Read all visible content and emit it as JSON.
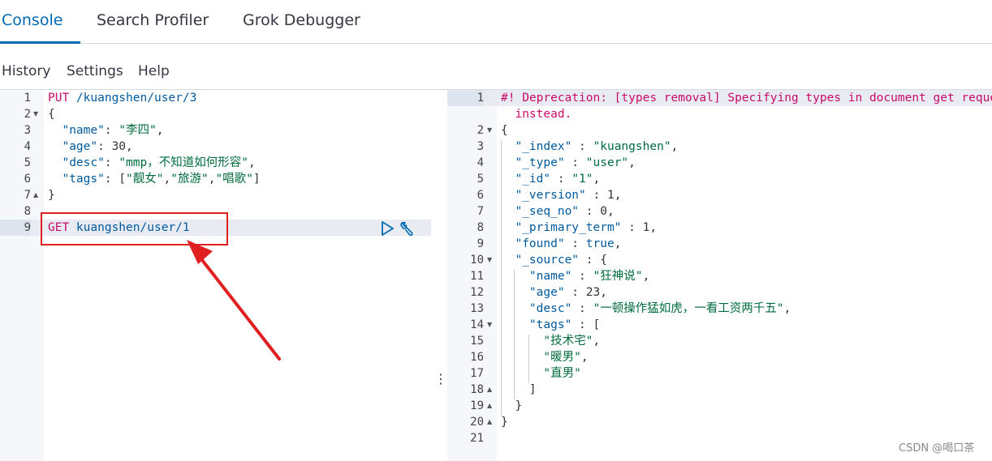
{
  "tabs": [
    {
      "label": "Console",
      "active": true
    },
    {
      "label": "Search Profiler",
      "active": false
    },
    {
      "label": "Grok Debugger",
      "active": false
    }
  ],
  "subnav": [
    {
      "label": "History"
    },
    {
      "label": "Settings"
    },
    {
      "label": "Help"
    }
  ],
  "colors": {
    "accent": "#006bb4",
    "highlight_box": "#e02020",
    "method": "#c80a68",
    "string": "#006b3e"
  },
  "request_editor": {
    "lines": [
      {
        "n": "1",
        "fold": "",
        "parts": [
          {
            "t": "PUT",
            "c": "method"
          },
          {
            "t": " /kuangshen/user/3",
            "c": "url"
          }
        ]
      },
      {
        "n": "2",
        "fold": "▼",
        "parts": [
          {
            "t": "{",
            "c": "punct"
          }
        ]
      },
      {
        "n": "3",
        "fold": "",
        "parts": [
          {
            "t": "  \"name\"",
            "c": "key"
          },
          {
            "t": ": ",
            "c": "punct"
          },
          {
            "t": "\"李四\"",
            "c": "str"
          },
          {
            "t": ",",
            "c": "punct"
          }
        ]
      },
      {
        "n": "4",
        "fold": "",
        "parts": [
          {
            "t": "  \"age\"",
            "c": "key"
          },
          {
            "t": ": ",
            "c": "punct"
          },
          {
            "t": "30",
            "c": "num"
          },
          {
            "t": ",",
            "c": "punct"
          }
        ]
      },
      {
        "n": "5",
        "fold": "",
        "parts": [
          {
            "t": "  \"desc\"",
            "c": "key"
          },
          {
            "t": ": ",
            "c": "punct"
          },
          {
            "t": "\"mmp，不知道如何形容\"",
            "c": "str"
          },
          {
            "t": ",",
            "c": "punct"
          }
        ]
      },
      {
        "n": "6",
        "fold": "",
        "parts": [
          {
            "t": "  \"tags\"",
            "c": "key"
          },
          {
            "t": ": [",
            "c": "punct"
          },
          {
            "t": "\"靓女\"",
            "c": "str"
          },
          {
            "t": ",",
            "c": "punct"
          },
          {
            "t": "\"旅游\"",
            "c": "str"
          },
          {
            "t": ",",
            "c": "punct"
          },
          {
            "t": "\"唱歌\"",
            "c": "str"
          },
          {
            "t": "]",
            "c": "punct"
          }
        ]
      },
      {
        "n": "7",
        "fold": "▲",
        "parts": [
          {
            "t": "}",
            "c": "punct"
          }
        ]
      },
      {
        "n": "8",
        "fold": "",
        "parts": []
      },
      {
        "n": "9",
        "fold": "",
        "active": true,
        "parts": [
          {
            "t": "GET",
            "c": "method"
          },
          {
            "t": " kuangshen/user/1",
            "c": "url"
          }
        ]
      }
    ]
  },
  "response_editor": {
    "lines": [
      {
        "n": "1",
        "fold": "",
        "active": true,
        "parts": [
          {
            "t": "#! Deprecation: [types removal] Specifying types in document get requests is deprecated, use the /{index}/_doc/{id} endpoint",
            "c": "warn"
          }
        ]
      },
      {
        "n": "",
        "fold": "",
        "parts": [
          {
            "t": "  instead.",
            "c": "warn"
          }
        ]
      },
      {
        "n": "2",
        "fold": "▼",
        "parts": [
          {
            "t": "{",
            "c": "punct"
          }
        ]
      },
      {
        "n": "3",
        "fold": "",
        "parts": [
          {
            "t": "  \"_index\"",
            "c": "key"
          },
          {
            "t": " : ",
            "c": "punct"
          },
          {
            "t": "\"kuangshen\"",
            "c": "str"
          },
          {
            "t": ",",
            "c": "punct"
          }
        ]
      },
      {
        "n": "4",
        "fold": "",
        "parts": [
          {
            "t": "  \"_type\"",
            "c": "key"
          },
          {
            "t": " : ",
            "c": "punct"
          },
          {
            "t": "\"user\"",
            "c": "str"
          },
          {
            "t": ",",
            "c": "punct"
          }
        ]
      },
      {
        "n": "5",
        "fold": "",
        "parts": [
          {
            "t": "  \"_id\"",
            "c": "key"
          },
          {
            "t": " : ",
            "c": "punct"
          },
          {
            "t": "\"1\"",
            "c": "str"
          },
          {
            "t": ",",
            "c": "punct"
          }
        ]
      },
      {
        "n": "6",
        "fold": "",
        "parts": [
          {
            "t": "  \"_version\"",
            "c": "key"
          },
          {
            "t": " : ",
            "c": "punct"
          },
          {
            "t": "1",
            "c": "num"
          },
          {
            "t": ",",
            "c": "punct"
          }
        ]
      },
      {
        "n": "7",
        "fold": "",
        "parts": [
          {
            "t": "  \"_seq_no\"",
            "c": "key"
          },
          {
            "t": " : ",
            "c": "punct"
          },
          {
            "t": "0",
            "c": "num"
          },
          {
            "t": ",",
            "c": "punct"
          }
        ]
      },
      {
        "n": "8",
        "fold": "",
        "parts": [
          {
            "t": "  \"_primary_term\"",
            "c": "key"
          },
          {
            "t": " : ",
            "c": "punct"
          },
          {
            "t": "1",
            "c": "num"
          },
          {
            "t": ",",
            "c": "punct"
          }
        ]
      },
      {
        "n": "9",
        "fold": "",
        "parts": [
          {
            "t": "  \"found\"",
            "c": "key"
          },
          {
            "t": " : ",
            "c": "punct"
          },
          {
            "t": "true",
            "c": "bool"
          },
          {
            "t": ",",
            "c": "punct"
          }
        ]
      },
      {
        "n": "10",
        "fold": "▼",
        "parts": [
          {
            "t": "  \"_source\"",
            "c": "key"
          },
          {
            "t": " : {",
            "c": "punct"
          }
        ]
      },
      {
        "n": "11",
        "fold": "",
        "parts": [
          {
            "t": "    \"name\"",
            "c": "key"
          },
          {
            "t": " : ",
            "c": "punct"
          },
          {
            "t": "\"狂神说\"",
            "c": "str"
          },
          {
            "t": ",",
            "c": "punct"
          }
        ]
      },
      {
        "n": "12",
        "fold": "",
        "parts": [
          {
            "t": "    \"age\"",
            "c": "key"
          },
          {
            "t": " : ",
            "c": "punct"
          },
          {
            "t": "23",
            "c": "num"
          },
          {
            "t": ",",
            "c": "punct"
          }
        ]
      },
      {
        "n": "13",
        "fold": "",
        "parts": [
          {
            "t": "    \"desc\"",
            "c": "key"
          },
          {
            "t": " : ",
            "c": "punct"
          },
          {
            "t": "\"一顿操作猛如虎，一看工资两千五\"",
            "c": "str"
          },
          {
            "t": ",",
            "c": "punct"
          }
        ]
      },
      {
        "n": "14",
        "fold": "▼",
        "parts": [
          {
            "t": "    \"tags\"",
            "c": "key"
          },
          {
            "t": " : [",
            "c": "punct"
          }
        ]
      },
      {
        "n": "15",
        "fold": "",
        "parts": [
          {
            "t": "      \"技术宅\"",
            "c": "str"
          },
          {
            "t": ",",
            "c": "punct"
          }
        ]
      },
      {
        "n": "16",
        "fold": "",
        "parts": [
          {
            "t": "      \"暖男\"",
            "c": "str"
          },
          {
            "t": ",",
            "c": "punct"
          }
        ]
      },
      {
        "n": "17",
        "fold": "",
        "parts": [
          {
            "t": "      \"直男\"",
            "c": "str"
          }
        ]
      },
      {
        "n": "18",
        "fold": "▲",
        "parts": [
          {
            "t": "    ]",
            "c": "punct"
          }
        ]
      },
      {
        "n": "19",
        "fold": "▲",
        "parts": [
          {
            "t": "  }",
            "c": "punct"
          }
        ]
      },
      {
        "n": "20",
        "fold": "▲",
        "parts": [
          {
            "t": "}",
            "c": "punct"
          }
        ]
      },
      {
        "n": "21",
        "fold": "",
        "parts": []
      }
    ]
  },
  "resizer_glyph": "⋮",
  "watermark": "CSDN @喝口茶"
}
